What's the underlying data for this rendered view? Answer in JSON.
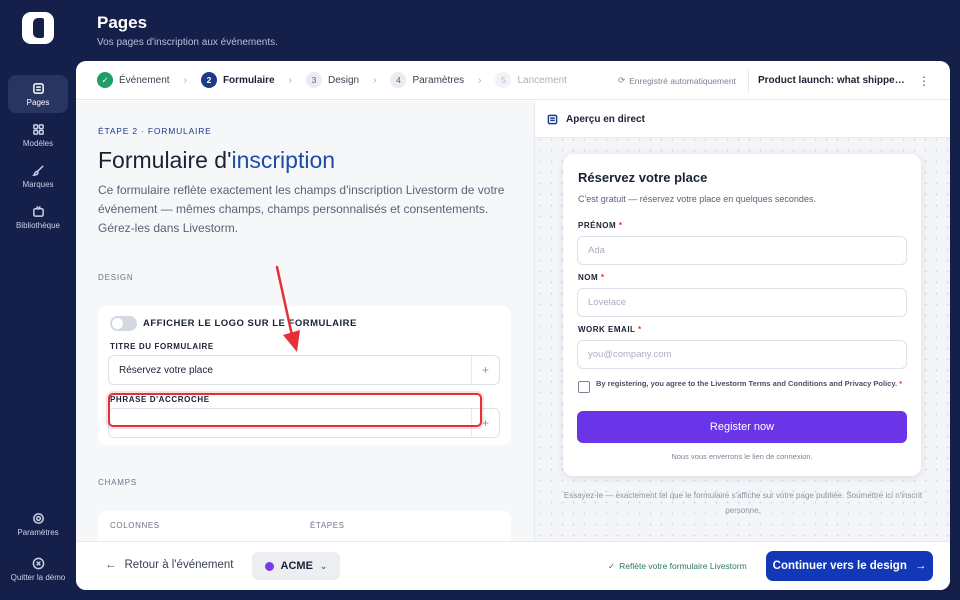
{
  "rail": {
    "items": [
      {
        "label": "Pages",
        "icon": "pages-icon"
      },
      {
        "label": "Modèles",
        "icon": "grid-icon"
      },
      {
        "label": "Marques",
        "icon": "brush-icon"
      },
      {
        "label": "Bibliothèque",
        "icon": "tv-icon"
      }
    ],
    "settings": "Paramètres",
    "quit": "Quitter la démo"
  },
  "header": {
    "title": "Pages",
    "subtitle": "Vos pages d'inscription aux événements."
  },
  "stepper": {
    "steps": [
      {
        "num": "✓",
        "label": "Événement",
        "state": "done"
      },
      {
        "num": "2",
        "label": "Formulaire",
        "state": "current"
      },
      {
        "num": "3",
        "label": "Design",
        "state": "todo"
      },
      {
        "num": "4",
        "label": "Paramètres",
        "state": "todo"
      },
      {
        "num": "5",
        "label": "Lancement",
        "state": "disabled"
      }
    ],
    "autosave": "Enregistré automatiquement",
    "event_name": "Product launch: what shipped this quarter",
    "more": "⋮"
  },
  "editor": {
    "eyebrow": "ÉTAPE 2 · FORMULAIRE",
    "title_prefix": "Formulaire d'",
    "title_accent": "inscription",
    "description": "Ce formulaire reflète exactement les champs d'inscription Livestorm de votre événement — mêmes champs, champs personnalisés et consentements. Gérez-les dans Livestorm.",
    "design_section": "DESIGN",
    "show_logo_label": "AFFICHER LE LOGO SUR LE FORMULAIRE",
    "show_logo": false,
    "form_title_label": "TITRE DU FORMULAIRE",
    "form_title_value": "Réservez votre place",
    "tagline_label": "PHRASE D'ACCROCHE",
    "tagline_value": "",
    "fields_section": "CHAMPS",
    "columns_label": "COLONNES",
    "steps_label": "ÉTAPES"
  },
  "preview": {
    "header": "Aperçu en direct",
    "form_title": "Réservez votre place",
    "form_subtitle": "C'est gratuit — réservez votre place en quelques secondes.",
    "fields": [
      {
        "label": "PRÉNOM",
        "placeholder": "Ada"
      },
      {
        "label": "NOM",
        "placeholder": "Lovelace"
      },
      {
        "label": "WORK EMAIL",
        "placeholder": "you@company.com"
      }
    ],
    "required_mark": "*",
    "consent": "By registering, you agree to the Livestorm Terms and Conditions and Privacy Policy.",
    "submit": "Register now",
    "note": "Nous vous enverrons le lien de connexion.",
    "try_note": "Essayez-le — exactement tel que le formulaire s'affiche sur votre page publiée. Soumettre ici n'inscrit personne."
  },
  "footer": {
    "back": "Retour à l'événement",
    "brand": "ACME",
    "brand_color": "#7c3aed",
    "reflect": "Reflète votre formulaire Livestorm",
    "continue": "Continuer vers le design"
  },
  "colors": {
    "navy": "#14204a",
    "primary": "#1338b7",
    "register_button": "#6a35e8",
    "annotation": "#e5303a"
  }
}
